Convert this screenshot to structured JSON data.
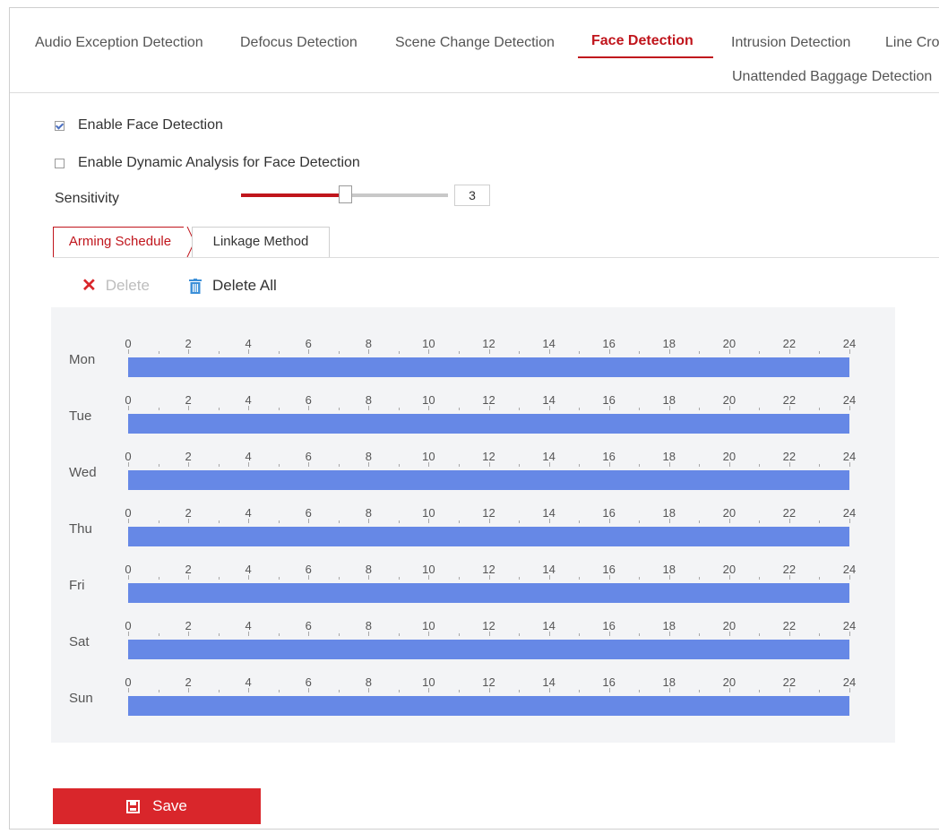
{
  "tabs": [
    {
      "label": "Audio Exception Detection",
      "active": false
    },
    {
      "label": "Defocus Detection",
      "active": false
    },
    {
      "label": "Scene Change Detection",
      "active": false
    },
    {
      "label": "Face Detection",
      "active": true
    },
    {
      "label": "Intrusion Detection",
      "active": false
    },
    {
      "label": "Line Cro",
      "active": false
    },
    {
      "label": "Unattended Baggage Detection",
      "active": false
    }
  ],
  "options": {
    "enable_face_detection": {
      "label": "Enable Face Detection",
      "checked": true
    },
    "enable_dynamic_analysis": {
      "label": "Enable Dynamic Analysis for Face Detection",
      "checked": false
    }
  },
  "sensitivity": {
    "label": "Sensitivity",
    "value": "3",
    "level": 0.5
  },
  "subtabs": {
    "arming": "Arming Schedule",
    "linkage": "Linkage Method"
  },
  "actions": {
    "delete": "Delete",
    "delete_all": "Delete All"
  },
  "schedule": {
    "hour_labels": [
      "0",
      "2",
      "4",
      "6",
      "8",
      "10",
      "12",
      "14",
      "16",
      "18",
      "20",
      "22",
      "24"
    ],
    "days": [
      {
        "name": "Mon",
        "start": 0,
        "end": 24
      },
      {
        "name": "Tue",
        "start": 0,
        "end": 24
      },
      {
        "name": "Wed",
        "start": 0,
        "end": 24
      },
      {
        "name": "Thu",
        "start": 0,
        "end": 24
      },
      {
        "name": "Fri",
        "start": 0,
        "end": 24
      },
      {
        "name": "Sat",
        "start": 0,
        "end": 24
      },
      {
        "name": "Sun",
        "start": 0,
        "end": 24
      }
    ]
  },
  "save_label": "Save",
  "colors": {
    "accent": "#c0151c",
    "bar": "#6688e6",
    "save": "#d9262b"
  }
}
